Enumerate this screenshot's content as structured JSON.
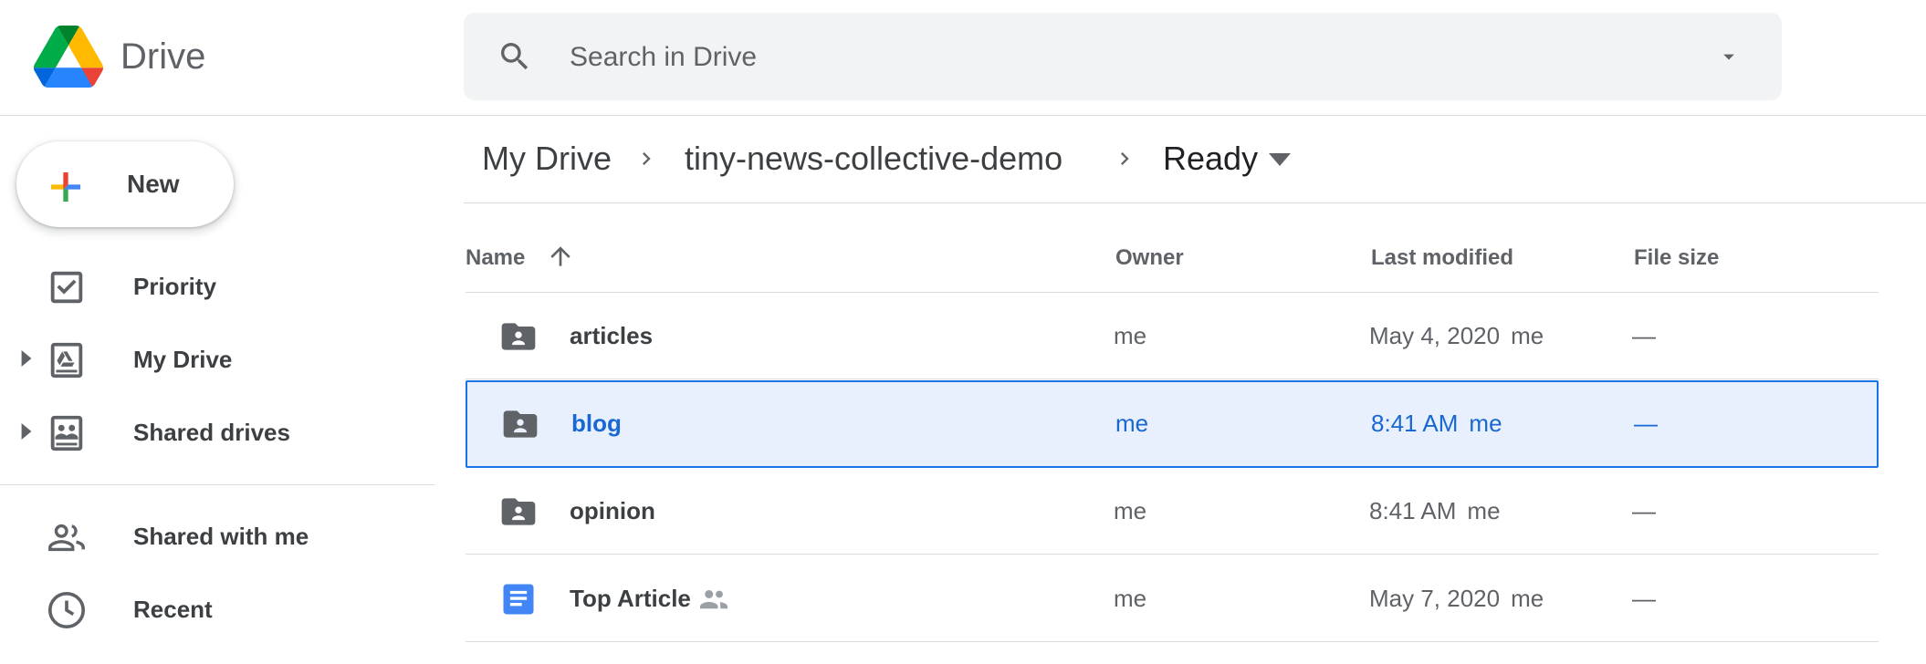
{
  "app": {
    "name": "Drive"
  },
  "search": {
    "placeholder": "Search in Drive"
  },
  "sidebar": {
    "new_label": "New",
    "items": [
      {
        "label": "Priority",
        "icon": "priority-check-icon"
      },
      {
        "label": "My Drive",
        "icon": "my-drive-icon",
        "expandable": true
      },
      {
        "label": "Shared drives",
        "icon": "shared-drives-icon",
        "expandable": true
      },
      {
        "label": "Shared with me",
        "icon": "people-icon"
      },
      {
        "label": "Recent",
        "icon": "clock-icon"
      }
    ]
  },
  "breadcrumb": {
    "items": [
      "My Drive",
      "tiny-news-collective-demo",
      "Ready"
    ]
  },
  "table": {
    "columns": {
      "name": "Name",
      "owner": "Owner",
      "modified": "Last modified",
      "size": "File size"
    },
    "sort": "name-ascending",
    "rows": [
      {
        "name": "articles",
        "type": "shared-folder",
        "owner": "me",
        "modified": "May 4, 2020",
        "modified_by": "me",
        "size": "—",
        "selected": false,
        "shared": false
      },
      {
        "name": "blog",
        "type": "shared-folder",
        "owner": "me",
        "modified": "8:41 AM",
        "modified_by": "me",
        "size": "—",
        "selected": true,
        "shared": false
      },
      {
        "name": "opinion",
        "type": "shared-folder",
        "owner": "me",
        "modified": "8:41 AM",
        "modified_by": "me",
        "size": "—",
        "selected": false,
        "shared": false
      },
      {
        "name": "Top Article",
        "type": "google-doc",
        "owner": "me",
        "modified": "May 7, 2020",
        "modified_by": "me",
        "size": "—",
        "selected": false,
        "shared": true
      }
    ]
  },
  "colors": {
    "accent": "#1a73e8",
    "selected_bg": "#e8f0fe",
    "selected_text": "#1967d2",
    "doc_blue": "#4285f4",
    "folder_gray": "#5f6368"
  }
}
